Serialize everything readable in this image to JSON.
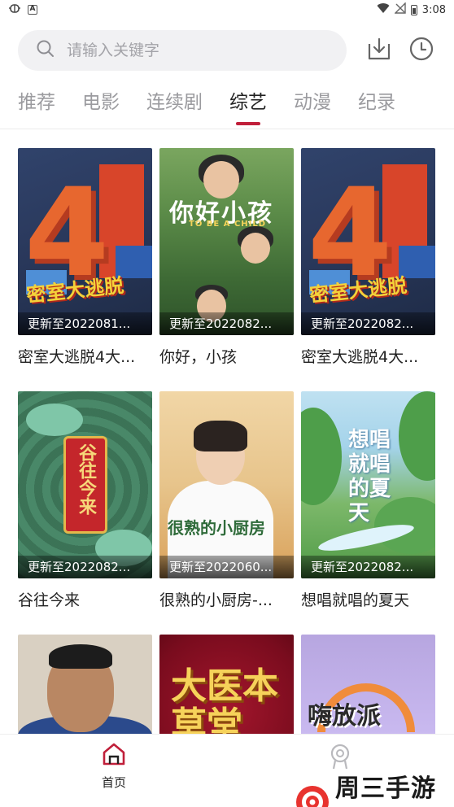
{
  "status_bar": {
    "time": "3:08",
    "left_icons": [
      "bug-icon",
      "a-icon"
    ],
    "right_icons": [
      "wifi-icon",
      "no-signal-icon",
      "battery-icon"
    ]
  },
  "search": {
    "placeholder": "请输入关键字",
    "download_icon": "download-icon",
    "history_icon": "clock-icon"
  },
  "tabs": [
    {
      "label": "推荐",
      "active": false
    },
    {
      "label": "电影",
      "active": false
    },
    {
      "label": "连续剧",
      "active": false
    },
    {
      "label": "综艺",
      "active": true
    },
    {
      "label": "动漫",
      "active": false
    },
    {
      "label": "纪录",
      "active": false
    }
  ],
  "accent_color": "#c01f3a",
  "cards": [
    {
      "title": "密室大逃脱4大...",
      "badge": "更新至2022081...",
      "poster_text": "密室大逃脱"
    },
    {
      "title": "你好，小孩",
      "badge": "更新至2022082...",
      "poster_text": "你好小孩",
      "poster_subtext": "TO BE A CHILD"
    },
    {
      "title": "密室大逃脱4大...",
      "badge": "更新至2022082...",
      "poster_text": "密室大逃脱"
    },
    {
      "title": "谷往今来",
      "badge": "更新至2022082...",
      "poster_text": "谷往今来"
    },
    {
      "title": "很熟的小厨房-...",
      "badge": "更新至2022060...",
      "poster_text": "很熟的小厨房"
    },
    {
      "title": "想唱就唱的夏天",
      "badge": "更新至2022082...",
      "poster_text": "想唱就唱的夏天"
    },
    {
      "title": "",
      "badge": "",
      "poster_text": ""
    },
    {
      "title": "",
      "badge": "",
      "poster_text": "大医本草堂"
    },
    {
      "title": "",
      "badge": "",
      "poster_text": "嗨放派"
    }
  ],
  "bottom_nav": {
    "home_label": "首页",
    "home_icon": "home-icon",
    "profile_icon": "profile-icon"
  },
  "watermark": {
    "text": "周三手游网"
  }
}
